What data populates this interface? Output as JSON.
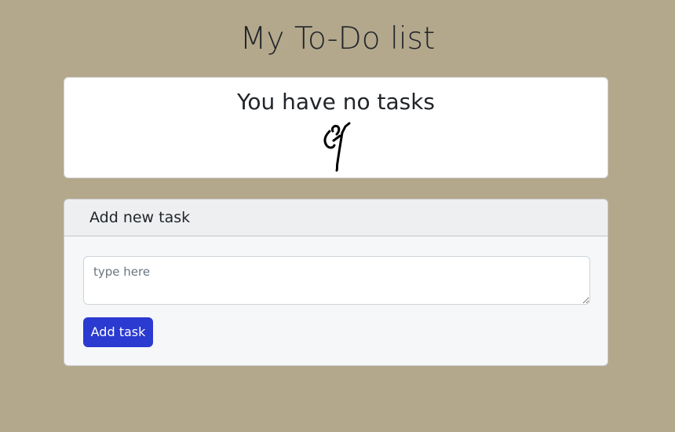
{
  "header": {
    "title": "My To-Do list"
  },
  "status_card": {
    "message": "You have no tasks",
    "icon": "dancing-stick-figure-icon"
  },
  "task_form": {
    "header_title": "Add new task",
    "input": {
      "value": "",
      "placeholder": "type here"
    },
    "submit_label": "Add task"
  },
  "colors": {
    "page_background": "#b3a88c",
    "button_primary": "#2b3ad0",
    "card_background": "#ffffff",
    "form_card_background": "#f6f7f9"
  }
}
